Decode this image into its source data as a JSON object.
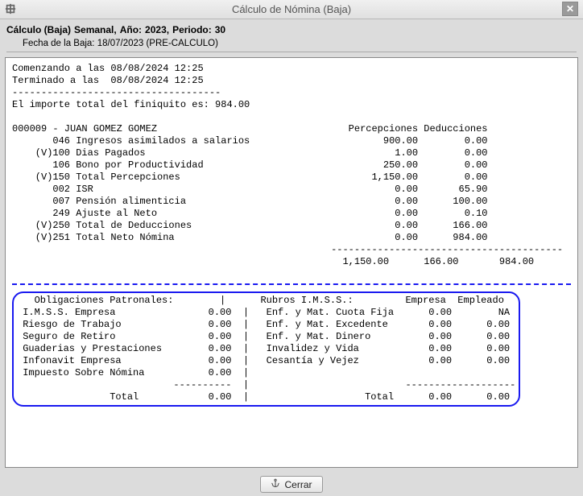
{
  "window": {
    "title": "Cálculo de Nómina (Baja)"
  },
  "header": {
    "calc_label": "Cálculo (Baja)",
    "period_type": "Semanal,",
    "year_label": "Año:",
    "year": "2023,",
    "period_label": "Periodo:",
    "period": "30",
    "low_date_label": "Fecha de la Baja:",
    "low_date": "18/07/2023 (PRE-CALCULO)"
  },
  "log": {
    "start": "Comenzando a las 08/08/2024 12:25",
    "end": "Terminado a las  08/08/2024 12:25",
    "sep": "------------------------------------",
    "total_line": "El importe total del finiquito es: 984.00"
  },
  "employee": {
    "id": "000009",
    "name": "JUAN GOMEZ GOMEZ",
    "cols_header_perc": "Percepciones",
    "cols_header_ded": "Deducciones"
  },
  "rows": [
    {
      "mark": "   ",
      "code": "046",
      "desc": "Ingresos asimilados a salarios",
      "perc": "900.00",
      "ded": "0.00"
    },
    {
      "mark": "(V)",
      "code": "100",
      "desc": "Dias Pagados",
      "perc": "1.00",
      "ded": "0.00"
    },
    {
      "mark": "   ",
      "code": "106",
      "desc": "Bono por Productividad",
      "perc": "250.00",
      "ded": "0.00"
    },
    {
      "mark": "(V)",
      "code": "150",
      "desc": "Total Percepciones",
      "perc": "1,150.00",
      "ded": "0.00"
    },
    {
      "mark": "   ",
      "code": "002",
      "desc": "ISR",
      "perc": "0.00",
      "ded": "65.90"
    },
    {
      "mark": "   ",
      "code": "007",
      "desc": "Pensión alimenticia",
      "perc": "0.00",
      "ded": "100.00"
    },
    {
      "mark": "   ",
      "code": "249",
      "desc": "Ajuste al Neto",
      "perc": "0.00",
      "ded": "0.10"
    },
    {
      "mark": "(V)",
      "code": "250",
      "desc": "Total de Deducciones",
      "perc": "0.00",
      "ded": "166.00"
    },
    {
      "mark": "(V)",
      "code": "251",
      "desc": "Total Neto Nómina",
      "perc": "0.00",
      "ded": "984.00"
    }
  ],
  "totals": {
    "perc": "1,150.00",
    "ded": "166.00",
    "net": "984.00"
  },
  "patronales": {
    "title": "Obligaciones Patronales:",
    "rows": [
      {
        "label": "I.M.S.S. Empresa",
        "val": "0.00"
      },
      {
        "label": "Riesgo de Trabajo",
        "val": "0.00"
      },
      {
        "label": "Seguro de Retiro",
        "val": "0.00"
      },
      {
        "label": "Guaderias y Prestaciones",
        "val": "0.00"
      },
      {
        "label": "Infonavit Empresa",
        "val": "0.00"
      },
      {
        "label": "Impuesto Sobre Nómina",
        "val": "0.00"
      }
    ],
    "total_label": "Total",
    "total_val": "0.00"
  },
  "imss": {
    "title": "Rubros I.M.S.S.:",
    "col_emp": "Empresa",
    "col_empl": "Empleado",
    "rows": [
      {
        "label": "Enf. y Mat. Cuota Fija",
        "emp": "0.00",
        "empl": "NA"
      },
      {
        "label": "Enf. y Mat. Excedente",
        "emp": "0.00",
        "empl": "0.00"
      },
      {
        "label": "Enf. y Mat. Dinero",
        "emp": "0.00",
        "empl": "0.00"
      },
      {
        "label": "Invalidez y Vida",
        "emp": "0.00",
        "empl": "0.00"
      },
      {
        "label": "Cesantía y Vejez",
        "emp": "0.00",
        "empl": "0.00"
      }
    ],
    "total_label": "Total",
    "total_emp": "0.00",
    "total_empl": "0.00"
  },
  "footer": {
    "close_label": "Cerrar"
  }
}
